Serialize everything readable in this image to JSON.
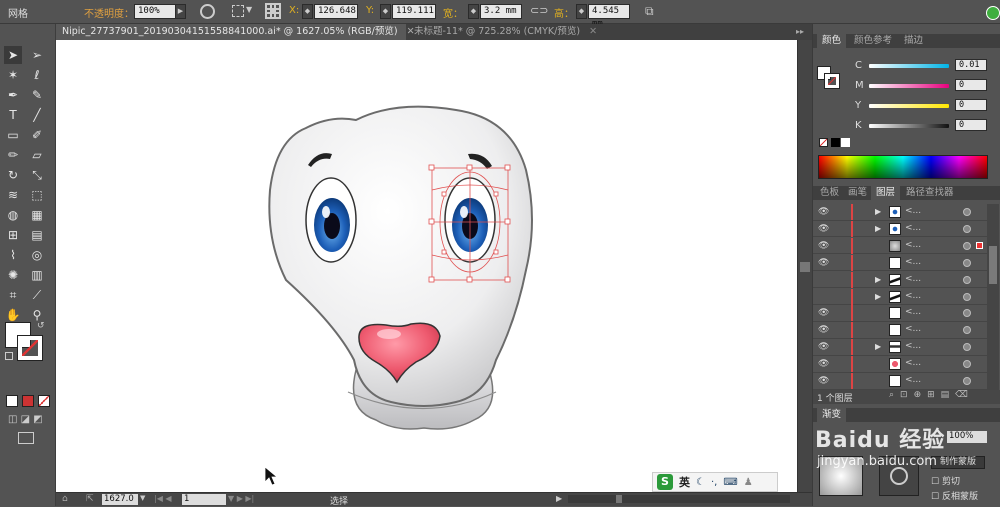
{
  "topbar": {
    "mode_label": "网格",
    "opacity_label": "不透明度：",
    "opacity_value": "100%",
    "x_label": "X:",
    "x_value": "126.648",
    "y_label": "Y:",
    "y_value": "119.111",
    "w_label": "宽：",
    "w_value": "3.2 mm",
    "h_label": "高：",
    "h_value": "4.545 mm"
  },
  "tabs": [
    {
      "label": "Nipic_27737901_20190304151558841000.ai* @ 1627.05% (RGB/预览)",
      "close": "✕"
    },
    {
      "label": "未标题-11* @ 725.28% (CMYK/预览)",
      "close": "✕"
    }
  ],
  "status": {
    "zoom": "1627.0",
    "page": "1",
    "tool": "选择"
  },
  "color_panel": {
    "tabs": [
      "颜色",
      "颜色参考",
      "描边"
    ],
    "channels": [
      {
        "label": "C",
        "value": "0.01",
        "color": "#00b4e6"
      },
      {
        "label": "M",
        "value": "0",
        "color": "#e6007e"
      },
      {
        "label": "Y",
        "value": "0",
        "color": "#ffe600"
      },
      {
        "label": "K",
        "value": "0",
        "color": "#111111"
      }
    ]
  },
  "layers_panel": {
    "tabs": [
      "色板",
      "画笔",
      "图层",
      "路径查找器"
    ],
    "footer": "1 个图层",
    "row_name": "<...",
    "rows": [
      {
        "visible": true,
        "expandable": true,
        "thumb": "eye"
      },
      {
        "visible": true,
        "expandable": true,
        "thumb": "eye"
      },
      {
        "visible": true,
        "expandable": false,
        "thumb": "gray"
      },
      {
        "visible": true,
        "expandable": false,
        "thumb": "white"
      },
      {
        "visible": false,
        "expandable": true,
        "thumb": "brow"
      },
      {
        "visible": false,
        "expandable": true,
        "thumb": "brow"
      },
      {
        "visible": true,
        "expandable": false,
        "thumb": "white"
      },
      {
        "visible": true,
        "expandable": false,
        "thumb": "white"
      },
      {
        "visible": true,
        "expandable": true,
        "thumb": "mouth"
      },
      {
        "visible": true,
        "expandable": false,
        "thumb": "nose"
      },
      {
        "visible": true,
        "expandable": false,
        "thumb": "white"
      }
    ]
  },
  "transparency_panel": {
    "tab": "渐变",
    "opacity_value": "100%",
    "make_mask": "制作蒙版",
    "clip": "剪切",
    "invert_mask": "反相蒙版"
  },
  "ime_bar": {
    "logo": "S",
    "lang": "英"
  },
  "watermark": {
    "brand": "Baidu 经验",
    "url": "jingyan.baidu.com"
  }
}
